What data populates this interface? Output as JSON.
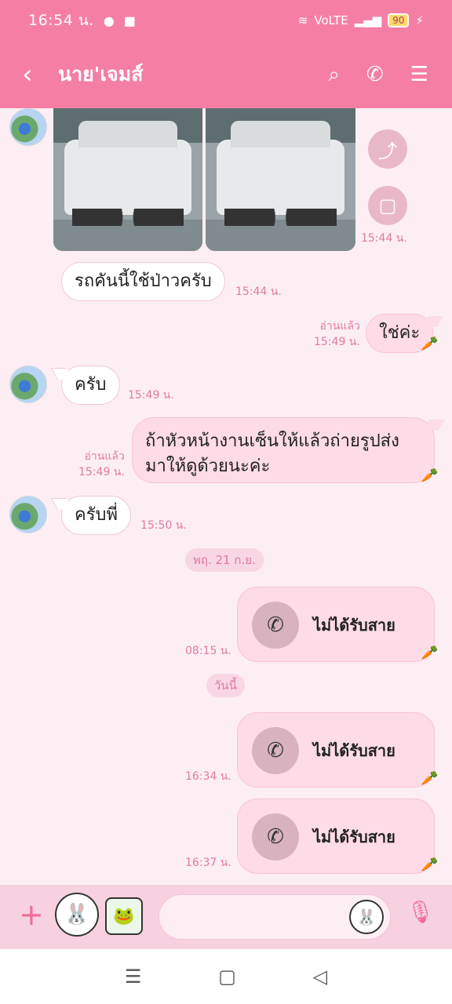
{
  "status": {
    "time": "16:54 น.",
    "right_text": "VoLTE",
    "battery": "90"
  },
  "header": {
    "title": "นาย'เจมส์",
    "icons": [
      "back-icon",
      "search-icon",
      "phone-icon",
      "menu-icon"
    ]
  },
  "messages": {
    "photo_time": "15:44 น.",
    "m1_text": "รถคันนี้ใช้ป่าวครับ",
    "m1_time": "15:44 น.",
    "m2_text": "ใช่ค่ะ",
    "m2_read": "อ่านแล้ว",
    "m2_time": "15:49 น.",
    "m3_text": "ครับ",
    "m3_time": "15:49 น.",
    "m4_line1": "ถ้าหัวหน้างานเซ็นให้แล้วถ่ายรูปส่ง",
    "m4_line2": "มาให้ดูด้วยนะค่ะ",
    "m4_read": "อ่านแล้ว",
    "m4_time": "15:49 น.",
    "m5_text": "ครับพี่",
    "m5_time": "15:50 น.",
    "date1": "พฤ. 21 ก.ย.",
    "call1_label": "ไม่ได้รับสาย",
    "call1_time": "08:15 น.",
    "date2": "วันนี้",
    "call2_label": "ไม่ได้รับสาย",
    "call2_time": "16:34 น.",
    "call3_label": "ไม่ได้รับสาย",
    "call3_time": "16:37 น."
  },
  "input": {
    "value": ""
  },
  "colors": {
    "header": "#f57fa4",
    "bubble_me": "#fddbe7",
    "background": "#fdeef3",
    "accent": "#f06b99"
  }
}
